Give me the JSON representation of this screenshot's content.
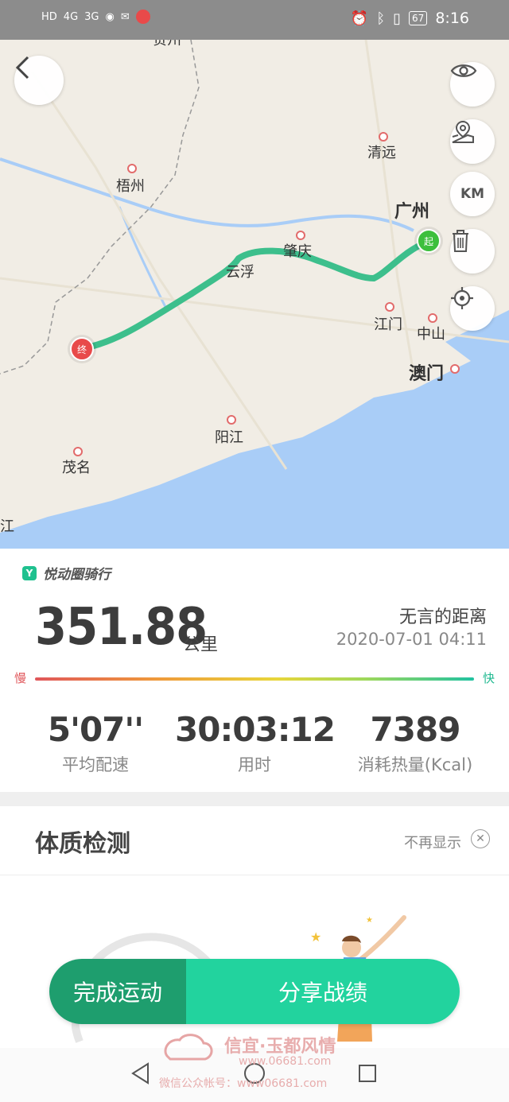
{
  "status_bar": {
    "left": [
      "HD",
      "4G",
      "3G"
    ],
    "time": "8:16",
    "battery": "67"
  },
  "map": {
    "cities": {
      "guangzhou": "广州",
      "qingyuan": "清远",
      "wuzhou": "梧州",
      "yunfu": "云浮",
      "zhaoqing": "肇庆",
      "jiangmen": "江门",
      "zhongshan": "中山",
      "macau": "澳门",
      "yangjiang": "阳江",
      "maoming": "茂名",
      "zhanjiang_partial": "江",
      "hezhou_partial": "贺州"
    },
    "start_label": "起",
    "end_label": "终",
    "controls": [
      "eye-icon",
      "map-pin-icon",
      "km-icon",
      "trash-icon",
      "locate-icon"
    ],
    "km_text": "KM",
    "colors": {
      "route": "#3dbf8c",
      "water": "#a9cdf7",
      "land": "#f1ede5"
    }
  },
  "summary": {
    "brand": "悦动圈骑行",
    "distance": "351.88",
    "distance_unit": "公里",
    "route_name": "无言的距离",
    "datetime": "2020-07-01 04:11",
    "slow_label": "慢",
    "fast_label": "快",
    "stats": [
      {
        "value": "5'07''",
        "label": "平均配速"
      },
      {
        "value": "30:03:12",
        "label": "用时"
      },
      {
        "value": "7389",
        "label": "消耗热量(Kcal)"
      }
    ]
  },
  "physique": {
    "title": "体质检测",
    "dismiss_label": "不再显示"
  },
  "actions": {
    "finish": "完成运动",
    "share": "分享战绩"
  },
  "watermark": {
    "line1": "信宜·玉都风情",
    "line2": "www.06681.com",
    "line3": "微信公众帐号：www06681.com"
  }
}
